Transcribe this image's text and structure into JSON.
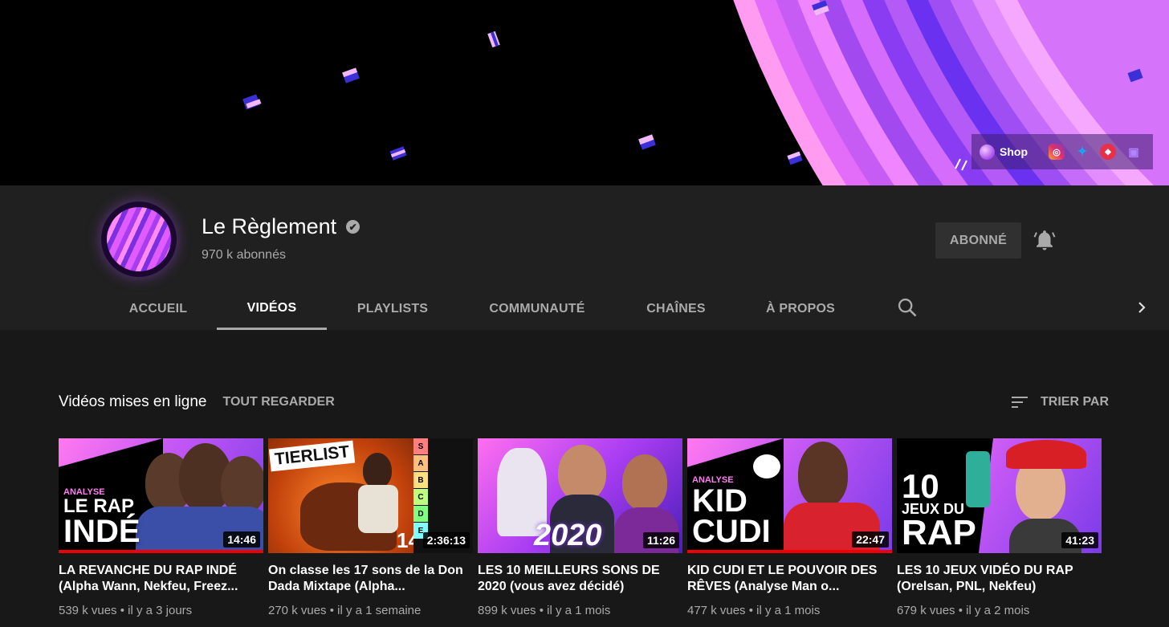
{
  "banner": {
    "links": {
      "shop_label": "Shop",
      "socials": [
        "instagram-icon",
        "twitter-icon",
        "link-icon",
        "twitch-icon"
      ]
    }
  },
  "channel": {
    "name": "Le Règlement",
    "verified_glyph": "✔",
    "subscribers": "970 k abonnés",
    "subscribe_label": "ABONNÉ"
  },
  "tabs": [
    {
      "label": "ACCUEIL"
    },
    {
      "label": "VIDÉOS",
      "active": true
    },
    {
      "label": "PLAYLISTS"
    },
    {
      "label": "COMMUNAUTÉ"
    },
    {
      "label": "CHAÎNES"
    },
    {
      "label": "À PROPOS"
    }
  ],
  "section": {
    "title": "Vidéos mises en ligne",
    "see_all": "TOUT REGARDER",
    "sort_label": "TRIER PAR"
  },
  "videos": [
    {
      "thumb_small": "ANALYSE",
      "thumb_line1": "LE RAP",
      "thumb_line2": "INDÉ",
      "duration": "14:46",
      "title": "LA REVANCHE DU RAP INDÉ (Alpha Wann, Nekfeu, Freez...",
      "meta": "539 k vues • il y a 3 jours",
      "watched": true
    },
    {
      "thumb_small": "TIERLIST",
      "thumb_tiers": [
        "S",
        "A",
        "B",
        "C",
        "D",
        "E"
      ],
      "thumb_number": "14",
      "duration": "2:36:13",
      "title": "On classe les 17 sons de la Don Dada Mixtape (Alpha...",
      "meta": "270 k vues • il y a 1 semaine",
      "watched": false
    },
    {
      "thumb_line1": "2020",
      "duration": "11:26",
      "title": "LES 10 MEILLEURS SONS DE 2020 (vous avez décidé)",
      "meta": "899 k vues • il y a 1 mois",
      "watched": false
    },
    {
      "thumb_small": "ANALYSE",
      "thumb_line1": "KID",
      "thumb_line2": "CUDI",
      "duration": "22:47",
      "title": "KID CUDI ET LE POUVOIR DES RÊVES (Analyse Man o...",
      "meta": "477 k vues • il y a 1 mois",
      "watched": true
    },
    {
      "thumb_line1": "10",
      "thumb_small": "JEUX DU",
      "thumb_line2": "RAP",
      "duration": "41:23",
      "title": "LES 10 JEUX VIDÉO DU RAP (Orelsan, PNL, Nekfeu)",
      "meta": "679 k vues • il y a 2 mois",
      "watched": false
    }
  ]
}
